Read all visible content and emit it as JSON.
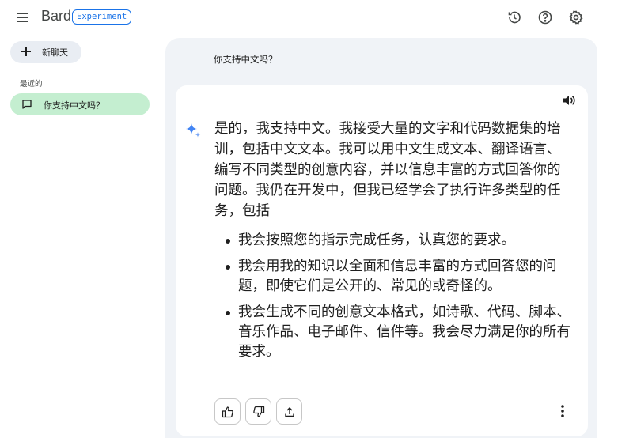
{
  "header": {
    "brand": "Bard",
    "badge": "Experiment",
    "icons": [
      "menu-icon",
      "history-icon",
      "help-icon",
      "settings-icon"
    ]
  },
  "sidebar": {
    "new_chat_label": "新聊天",
    "recent_title": "最近的",
    "recent_items": [
      {
        "label": "你支持中文吗？"
      }
    ]
  },
  "conversation": {
    "user_prompt": "你支持中文吗？",
    "response": {
      "paragraph": "是的，我支持中文。我接受大量的文字和代码数据集的培训，包括中文文本。我可以用中文生成文本、翻译语言、编写不同类型的创意内容，并以信息丰富的方式回答你的问题。我仍在开发中，但我已经学会了执行许多类型的任务，包括",
      "bullets": [
        "我会按照您的指示完成任务，认真您的要求。",
        "我会用我的知识以全面和信息丰富的方式回答您的问题，即使它们是公开的、常见的或奇怪的。",
        "我会生成不同的创意文本格式，如诗歌、代码、脚本、音乐作品、电子邮件、信件等。我会尽力满足你的所有要求。"
      ]
    },
    "actions": [
      "thumbs-up-icon",
      "thumbs-down-icon",
      "share-icon",
      "more-vert-icon"
    ]
  },
  "colors": {
    "accent": "#1a73e8",
    "selected_chat": "#c4eed0",
    "main_background": "#f0f3f7",
    "sparkle": "#4285f4"
  }
}
